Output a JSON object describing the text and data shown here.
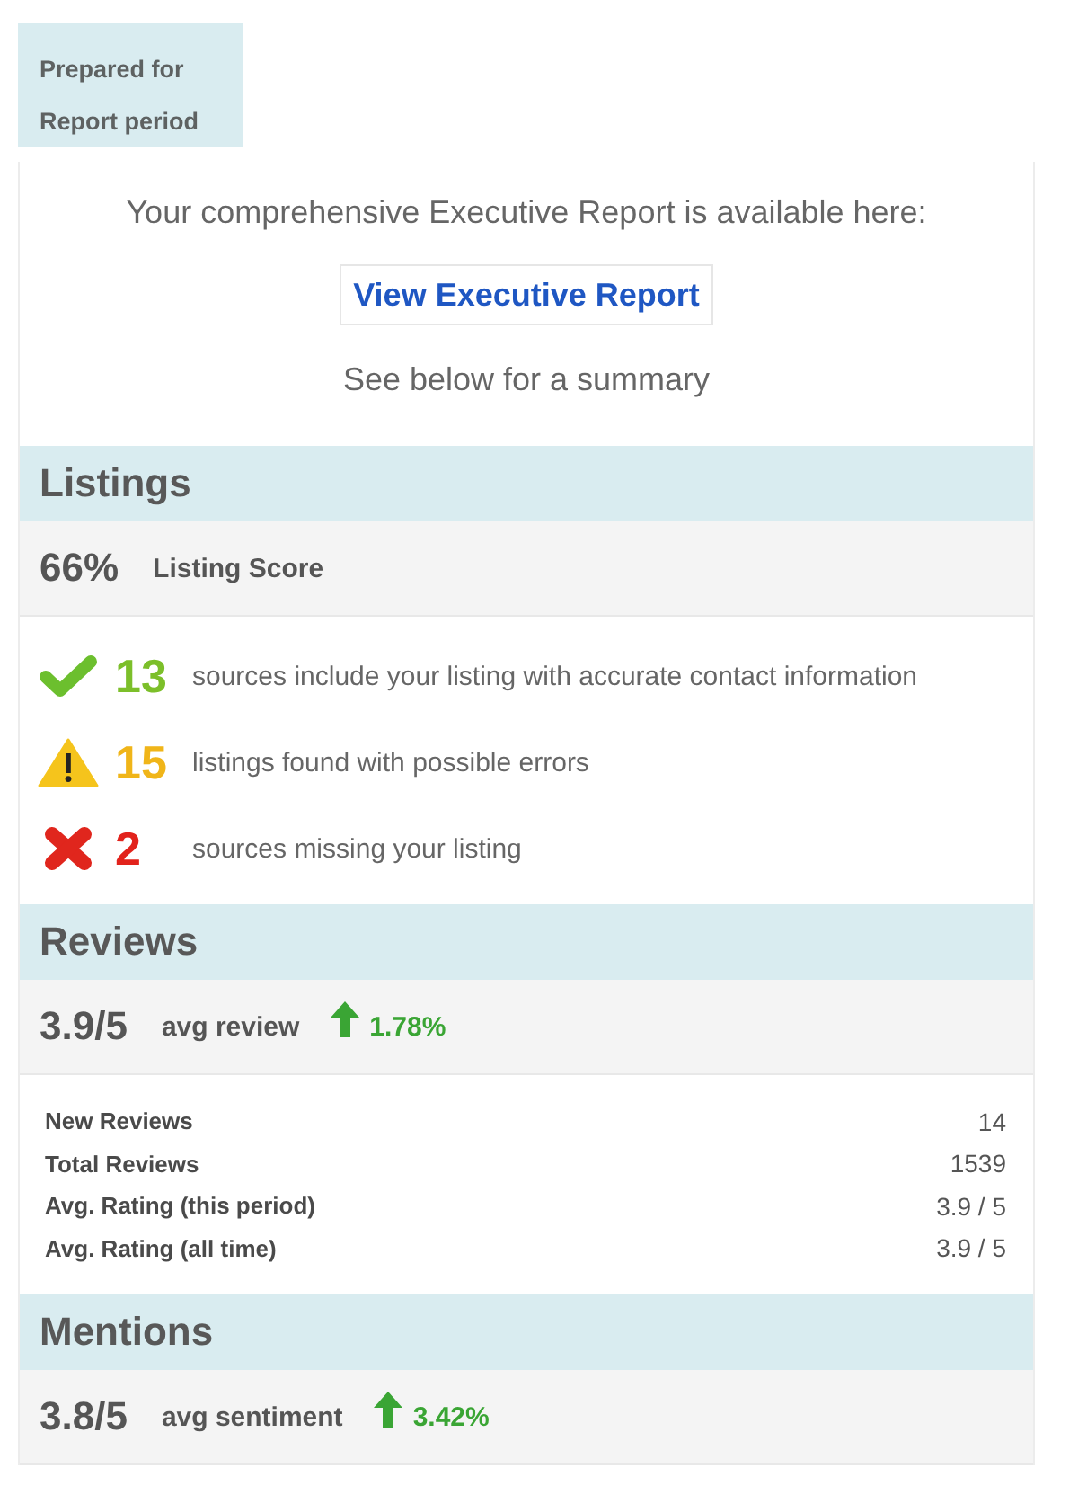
{
  "header_tab": {
    "lines": [
      "Prepared for",
      "Report period"
    ]
  },
  "intro": {
    "text": "Your comprehensive Executive Report is available here:",
    "button": "View Executive Report",
    "subtext": "See below for a summary"
  },
  "sections": [
    {
      "title": "Listings",
      "score": "66%",
      "score_label": "Listing Score",
      "items": [
        {
          "kind": "success",
          "count": "13",
          "text": "sources include your listing with accurate contact information"
        },
        {
          "kind": "warning",
          "count": "15",
          "text": "listings found with possible errors"
        },
        {
          "kind": "error",
          "count": "2",
          "text": "sources missing your listing"
        }
      ]
    },
    {
      "title": "Reviews",
      "score": "3.9/5",
      "score_label": "avg review",
      "trend": {
        "kind": "up",
        "value": "1.78%"
      },
      "stats": [
        {
          "label": "New Reviews",
          "value": "14"
        },
        {
          "label": "Total Reviews",
          "value": "1539"
        },
        {
          "label": "Avg. Rating (this period)",
          "value": "3.9 / 5"
        },
        {
          "label": "Avg. Rating (all time)",
          "value": "3.9 / 5"
        }
      ]
    },
    {
      "title": "Mentions",
      "score": "3.8/5",
      "score_label": "avg sentiment",
      "trend": {
        "kind": "up",
        "value": "3.42%"
      }
    }
  ]
}
